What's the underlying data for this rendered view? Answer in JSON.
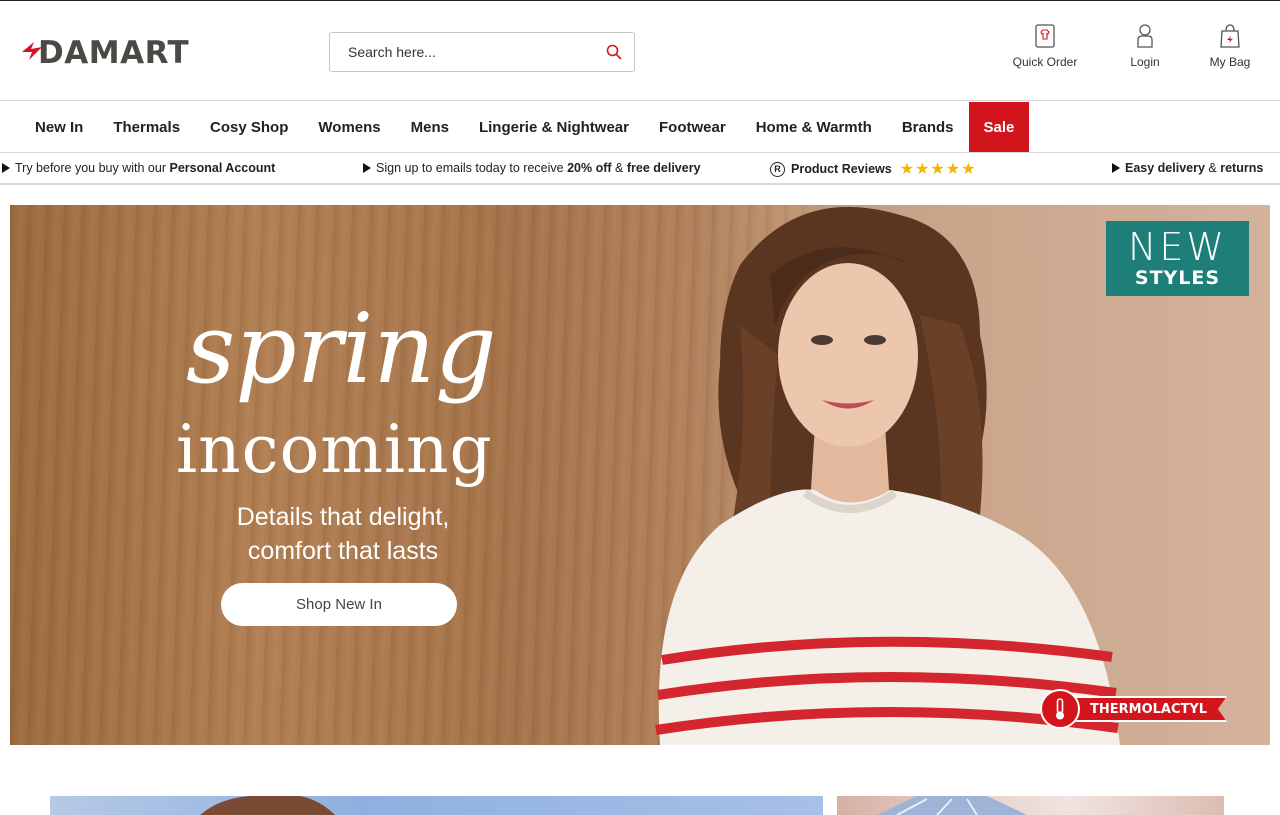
{
  "header": {
    "logo_text": "DAMART",
    "search": {
      "placeholder": "Search here..."
    },
    "actions": [
      {
        "label": "Quick Order",
        "icon": "quick-order-icon"
      },
      {
        "label": "Login",
        "icon": "user-icon"
      },
      {
        "label": "My Bag",
        "icon": "bag-icon"
      }
    ]
  },
  "nav": {
    "items": [
      "New In",
      "Thermals",
      "Cosy Shop",
      "Womens",
      "Mens",
      "Lingerie & Nightwear",
      "Footwear",
      "Home & Warmth",
      "Brands",
      "Sale"
    ]
  },
  "usp": {
    "try": {
      "text": "Try before you buy with our ",
      "bold": "Personal Account"
    },
    "signup": {
      "text": "Sign up to emails today to receive ",
      "bold1": "20% off",
      "mid": " & ",
      "bold2": "free delivery"
    },
    "reviews": {
      "reg": "R",
      "label": "Product Reviews",
      "stars": "★★★★★"
    },
    "delivery": {
      "bold1": "Easy delivery",
      "mid": " & ",
      "bold2": "returns"
    }
  },
  "hero": {
    "title1": "spring",
    "title2": "incoming",
    "subtitle_line1": "Details that delight,",
    "subtitle_line2": "comfort that lasts",
    "button": "Shop New In",
    "badge_line1": "NEW",
    "badge_line2": "STYLES",
    "thermo_label": "THERMOLACTYL"
  },
  "colors": {
    "accent_red": "#d2151c",
    "badge_teal": "#1e7f78",
    "star_gold": "#f2b600"
  }
}
